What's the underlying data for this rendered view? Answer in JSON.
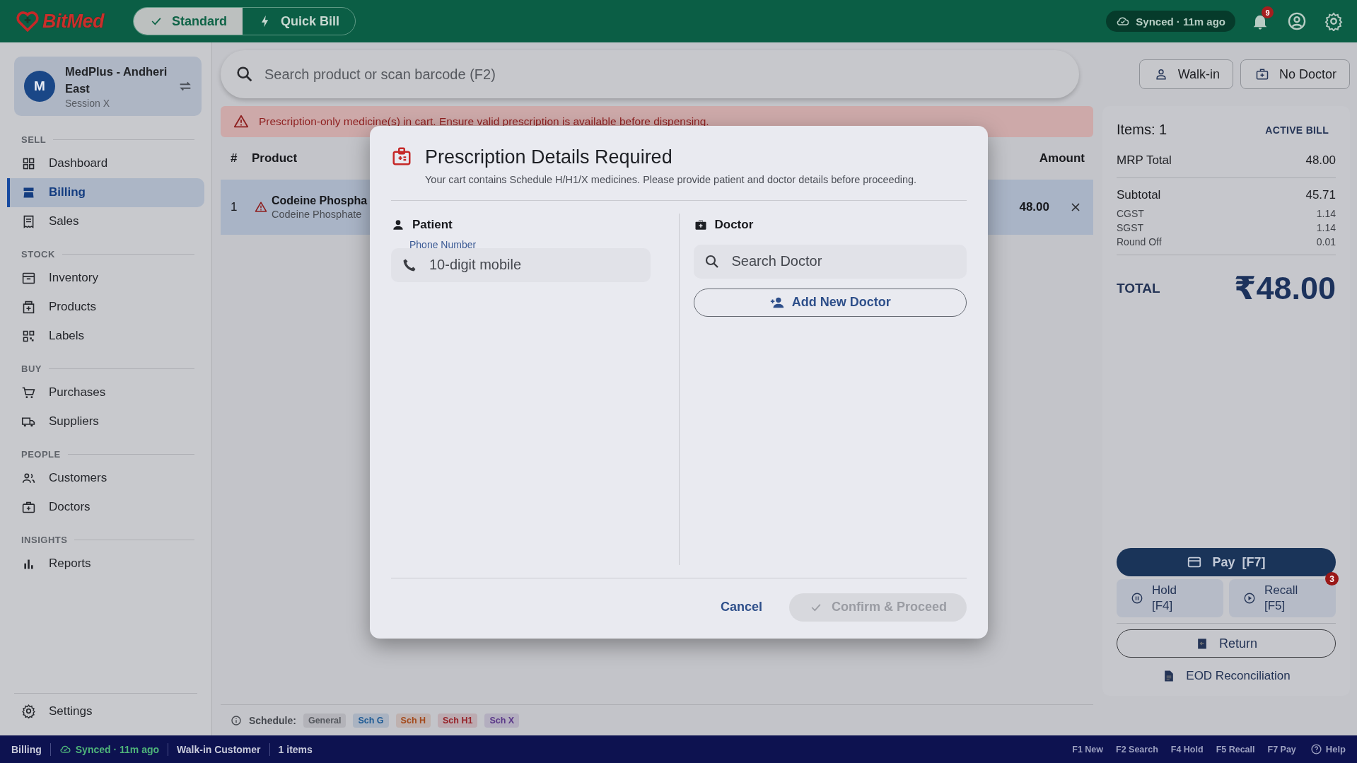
{
  "topbar": {
    "logo": "BitMed",
    "modes": [
      {
        "label": "Standard",
        "selected": true
      },
      {
        "label": "Quick Bill",
        "selected": false
      }
    ],
    "sync": "Synced · 11m ago",
    "notifications": "9"
  },
  "store": {
    "avatar": "M",
    "name": "MedPlus - Andheri East",
    "session": "Session X"
  },
  "sidebar": {
    "sections": [
      {
        "title": "SELL",
        "items": [
          {
            "label": "Dashboard",
            "selected": false
          },
          {
            "label": "Billing",
            "selected": true
          },
          {
            "label": "Sales",
            "selected": false
          }
        ]
      },
      {
        "title": "STOCK",
        "items": [
          {
            "label": "Inventory",
            "selected": false
          },
          {
            "label": "Products",
            "selected": false
          },
          {
            "label": "Labels",
            "selected": false
          }
        ]
      },
      {
        "title": "BUY",
        "items": [
          {
            "label": "Purchases",
            "selected": false
          },
          {
            "label": "Suppliers",
            "selected": false
          }
        ]
      },
      {
        "title": "PEOPLE",
        "items": [
          {
            "label": "Customers",
            "selected": false
          },
          {
            "label": "Doctors",
            "selected": false
          }
        ]
      },
      {
        "title": "INSIGHTS",
        "items": [
          {
            "label": "Reports",
            "selected": false
          }
        ]
      }
    ],
    "footer": "Settings"
  },
  "search": {
    "placeholder": "Search product or scan barcode (F2)"
  },
  "customer_buttons": [
    "Walk-in",
    "No Doctor"
  ],
  "alert": "Prescription-only medicine(s) in cart. Ensure valid prescription is available before dispensing.",
  "table": {
    "columns": [
      "#",
      "Product",
      "Amount"
    ],
    "rows": [
      {
        "index": "1",
        "name": "Codeine Phospha",
        "subtitle": "Codeine Phosphate",
        "amount": "48.00",
        "warning": true
      }
    ]
  },
  "schedule": {
    "label": "Schedule:",
    "tags": [
      {
        "label": "General",
        "color": "#55585e"
      },
      {
        "label": "Sch G",
        "color": "#1d5a94"
      },
      {
        "label": "Sch H",
        "color": "#a3491a"
      },
      {
        "label": "Sch H1",
        "color": "#962228"
      },
      {
        "label": "Sch X",
        "color": "#5a3788"
      }
    ]
  },
  "bill": {
    "items": "Items: 1",
    "badge": "ACTIVE BILL",
    "mrp": {
      "label": "MRP Total",
      "value": "48.00"
    },
    "lines": [
      {
        "label": "Subtotal",
        "value": "45.71",
        "kind": "major"
      },
      {
        "label": "CGST",
        "value": "1.14",
        "kind": "minor"
      },
      {
        "label": "SGST",
        "value": "1.14",
        "kind": "minor"
      },
      {
        "label": "Round Off",
        "value": "0.01",
        "kind": "minor"
      }
    ],
    "total": {
      "label": "TOTAL",
      "value": "₹48.00"
    },
    "pay": "Pay  [F7]",
    "hold": "Hold [F4]",
    "recall": "Recall [F5]",
    "recall_badge": "3",
    "return": "Return",
    "eod": "EOD Reconciliation"
  },
  "dialog": {
    "title": "Prescription Details Required",
    "description": "Your cart contains Schedule H/H1/X medicines. Please provide patient and doctor details before proceeding.",
    "patient": {
      "heading": "Patient",
      "phone_label": "Phone Number",
      "phone_placeholder": "10-digit mobile"
    },
    "doctor": {
      "heading": "Doctor",
      "search_placeholder": "Search Doctor",
      "add_button": "Add New Doctor"
    },
    "actions": [
      {
        "label": "Cancel",
        "kind": "text",
        "disabled": false
      },
      {
        "label": "Confirm & Proceed",
        "kind": "filled",
        "disabled": true
      }
    ]
  },
  "status_bar": {
    "segments": [
      {
        "text": "Billing",
        "kind": "title"
      },
      {
        "text": "Synced · 11m ago",
        "kind": "sync"
      },
      {
        "text": "Walk-in Customer",
        "kind": "plain"
      },
      {
        "text": "1 items",
        "kind": "plain"
      }
    ],
    "shortcuts": [
      "F1 New",
      "F2 Search",
      "F4 Hold",
      "F5 Recall",
      "F7 Pay"
    ],
    "help": "Help"
  }
}
